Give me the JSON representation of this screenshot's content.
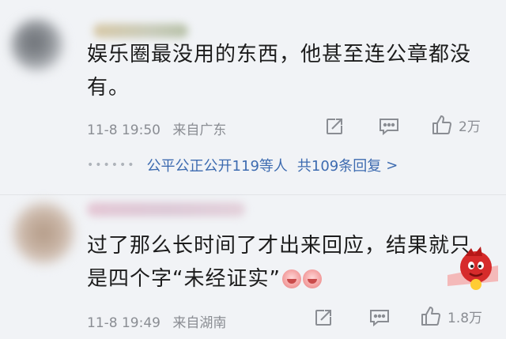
{
  "comments": [
    {
      "text": "娱乐圈最没用的东西，他甚至连公章都没有。",
      "date": "11-8 19:50",
      "location": "来自广东",
      "likes": "2万",
      "reply_summary": {
        "names": "公平公正公开119等人",
        "total": "共109条回复",
        "chevron": ">"
      }
    },
    {
      "text": "过了那么长时间了才出来回应，结果就只是四个字“未经证实”",
      "date": "11-8 19:49",
      "location": "来自湖南",
      "likes": "1.8万"
    }
  ],
  "icons": {
    "share": "share-square-icon",
    "comment": "comment-bubble-icon",
    "like": "thumbs-up-icon",
    "emoji": "laughing-emoji-icon",
    "sticker": "red-mascot-sticker-icon"
  },
  "colors": {
    "background": "#f1f3f6",
    "text": "#1c1c1c",
    "meta": "#8a8d93",
    "link": "#3d6bb0"
  }
}
